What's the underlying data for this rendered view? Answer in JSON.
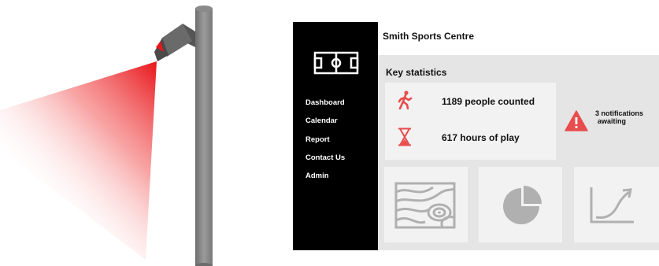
{
  "app": {
    "title": "Smith Sports Centre"
  },
  "sidebar": {
    "items": [
      {
        "label": "Dashboard"
      },
      {
        "label": "Calendar"
      },
      {
        "label": "Report"
      },
      {
        "label": "Contact Us"
      },
      {
        "label": "Admin"
      }
    ]
  },
  "key_stats": {
    "title": "Key statistics",
    "people": {
      "icon": "walking-person-icon",
      "text": "1189 people counted"
    },
    "hours": {
      "icon": "hourglass-icon",
      "text": "617  hours of play"
    }
  },
  "notifications": {
    "icon": "warning-icon",
    "line1": "3 notifications",
    "line2": "awaiting"
  },
  "tiles": [
    {
      "icon": "field-map-icon"
    },
    {
      "icon": "pie-chart-icon"
    },
    {
      "icon": "line-chart-icon"
    }
  ],
  "colors": {
    "accent": "#e84c4c",
    "sidebar": "#000000",
    "content_bg": "#e5e5e5",
    "card_bg": "#f2f2f2",
    "icon_grey": "#b0b0b0"
  }
}
